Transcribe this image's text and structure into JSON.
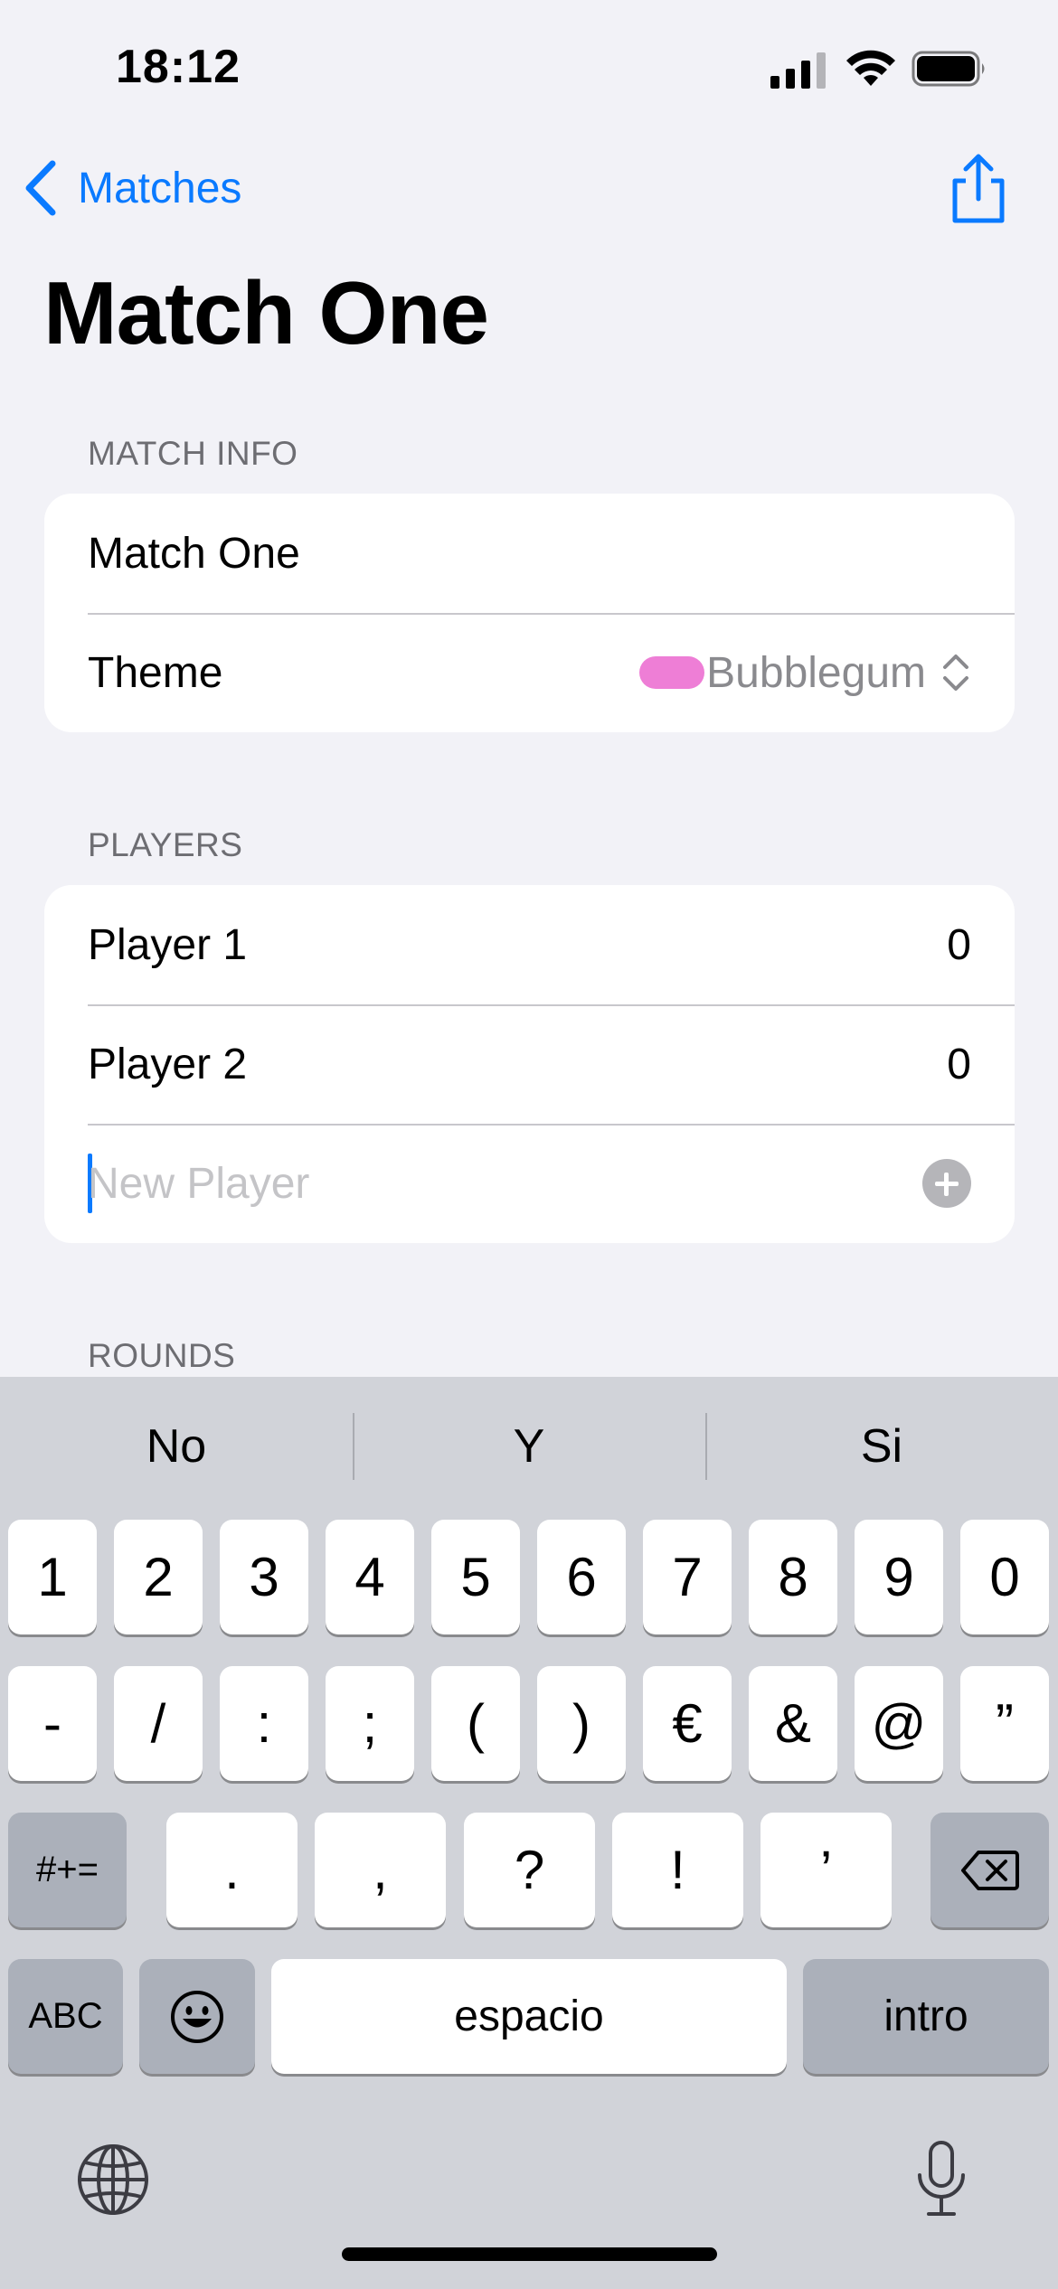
{
  "status_bar": {
    "time": "18:12"
  },
  "nav": {
    "back_label": "Matches",
    "title": "Match One"
  },
  "match_info": {
    "header": "MATCH INFO",
    "name_value": "Match One",
    "theme_label": "Theme",
    "theme_value": "Bubblegum",
    "theme_color": "#ee7ed6"
  },
  "players": {
    "header": "PLAYERS",
    "list": [
      {
        "name": "Player 1",
        "score": "0"
      },
      {
        "name": "Player 2",
        "score": "0"
      }
    ],
    "new_player_placeholder": "New Player"
  },
  "rounds": {
    "header": "ROUNDS"
  },
  "keyboard": {
    "suggestions": [
      "No",
      "Y",
      "Si"
    ],
    "row1": [
      "1",
      "2",
      "3",
      "4",
      "5",
      "6",
      "7",
      "8",
      "9",
      "0"
    ],
    "row2": [
      "-",
      "/",
      ":",
      ";",
      "(",
      ")",
      "€",
      "&",
      "@",
      "”"
    ],
    "row3": {
      "mode": "#+=",
      "keys": [
        ".",
        ",",
        "?",
        "!",
        "’"
      ]
    },
    "row4": {
      "abc": "ABC",
      "space": "espacio",
      "return": "intro"
    }
  },
  "colors": {
    "accent": "#0a7aff",
    "background": "#f2f2f7",
    "keyboard_bg": "#d1d3d9"
  }
}
